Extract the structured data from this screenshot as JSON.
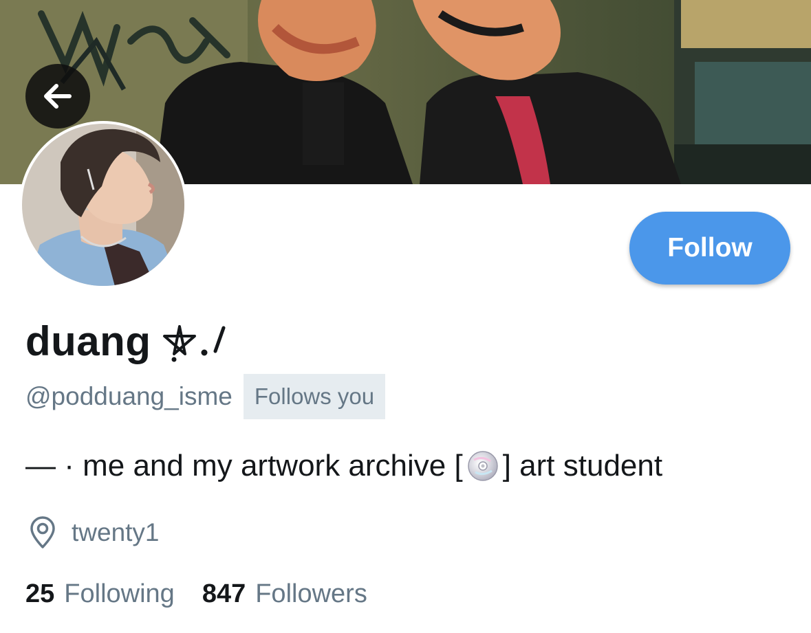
{
  "profile": {
    "display_name": "duang",
    "name_decoration": "⛧.⁄",
    "handle": "@podduang_isme",
    "follows_you_label": "Follows you",
    "bio_prefix": "— · me and my artwork archive [",
    "bio_suffix": "] art student",
    "location": "twenty1"
  },
  "stats": {
    "following_count": "25",
    "following_label": "Following",
    "followers_count": "847",
    "followers_label": "Followers"
  },
  "actions": {
    "follow_label": "Follow"
  },
  "icons": {
    "back": "arrow-left-icon",
    "location": "location-pin-icon",
    "bio_emoji": "optical-disc-icon"
  },
  "colors": {
    "follow_button": "#4b97ea",
    "text_primary": "#14171a",
    "text_secondary": "#657786",
    "badge_background": "#e6ecf0"
  }
}
